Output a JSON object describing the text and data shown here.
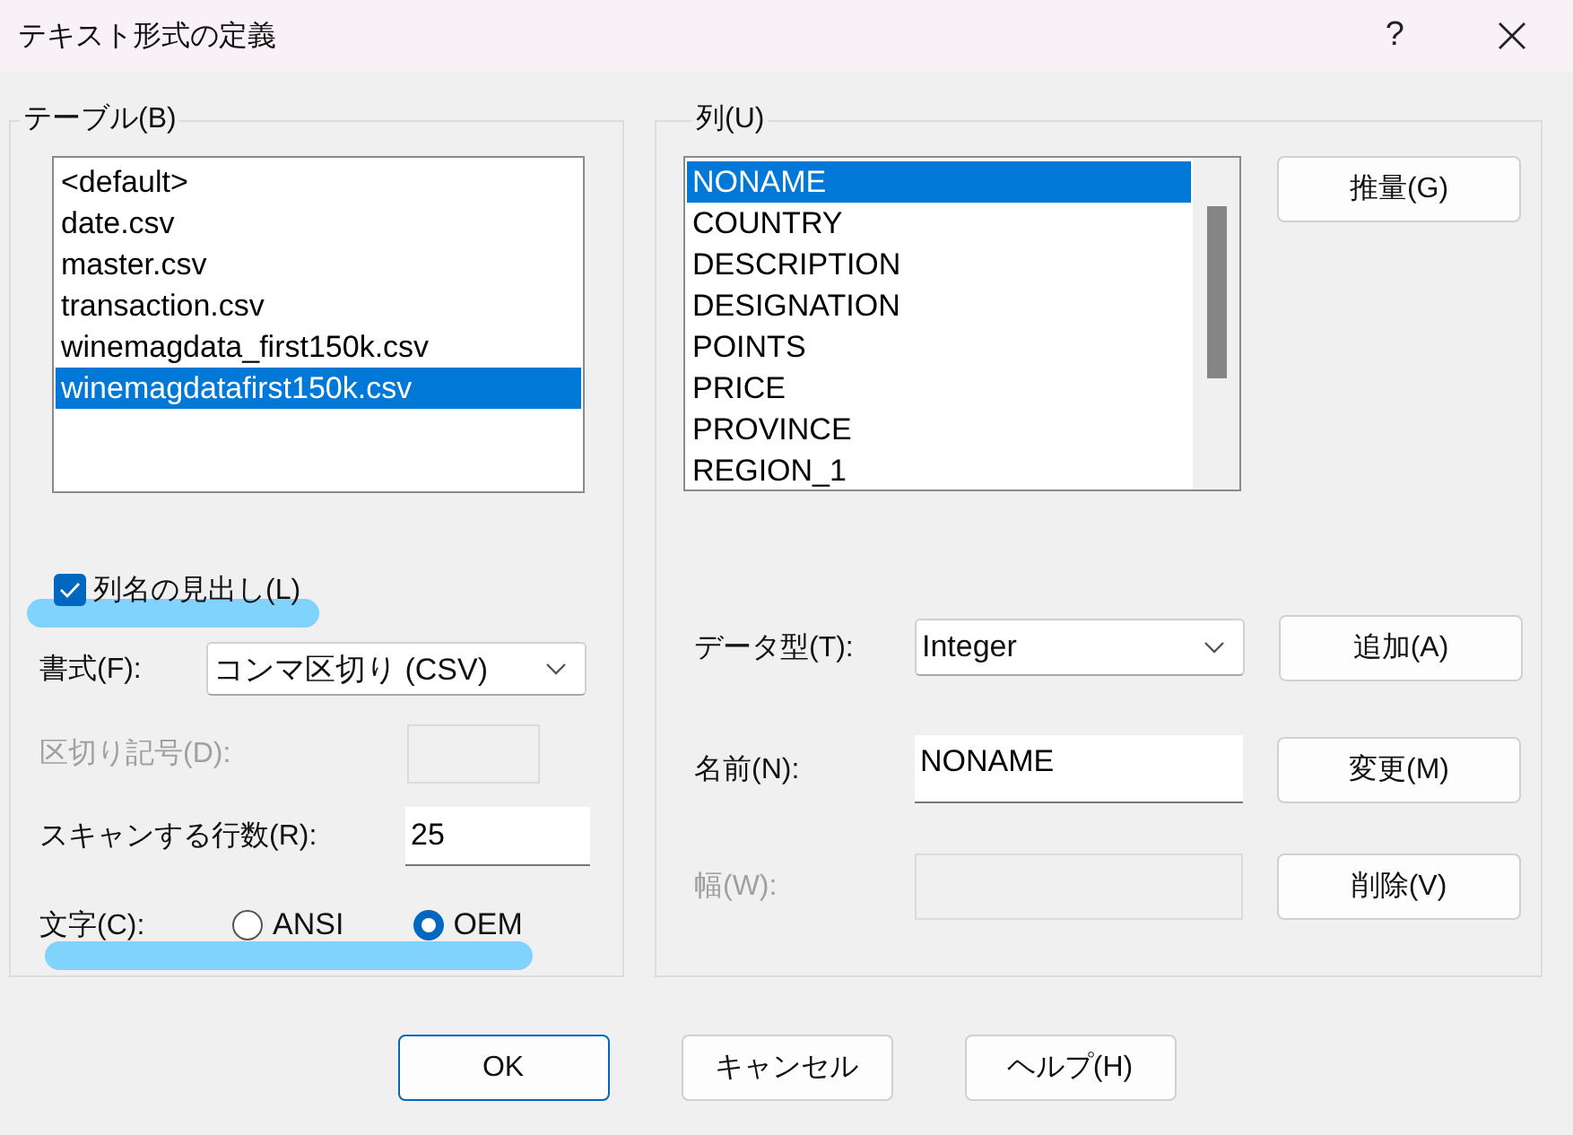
{
  "window": {
    "title": "テキスト形式の定義",
    "help_button": "?"
  },
  "table_group": {
    "label": "テーブル(B)",
    "tables": [
      {
        "name": "<default>",
        "selected": false
      },
      {
        "name": "date.csv",
        "selected": false
      },
      {
        "name": "master.csv",
        "selected": false
      },
      {
        "name": "transaction.csv",
        "selected": false
      },
      {
        "name": "winemagdata_first150k.csv",
        "selected": false
      },
      {
        "name": "winemagdatafirst150k.csv",
        "selected": true
      }
    ],
    "header_checkbox": {
      "label": "列名の見出し(L)",
      "checked": true
    },
    "format": {
      "label": "書式(F):",
      "value": "コンマ区切り (CSV)"
    },
    "delimiter": {
      "label": "区切り記号(D):",
      "disabled": true
    },
    "scan_rows": {
      "label": "スキャンする行数(R):",
      "value": "25"
    },
    "charset": {
      "label": "文字(C):",
      "options": [
        {
          "label": "ANSI",
          "selected": false
        },
        {
          "label": "OEM",
          "selected": true
        }
      ]
    }
  },
  "column_group": {
    "label": "列(U)",
    "columns": [
      {
        "name": "NONAME",
        "selected": true
      },
      {
        "name": "COUNTRY",
        "selected": false
      },
      {
        "name": "DESCRIPTION",
        "selected": false
      },
      {
        "name": "DESIGNATION",
        "selected": false
      },
      {
        "name": "POINTS",
        "selected": false
      },
      {
        "name": "PRICE",
        "selected": false
      },
      {
        "name": "PROVINCE",
        "selected": false
      },
      {
        "name": "REGION_1",
        "selected": false
      }
    ],
    "guess_button": "推量(G)",
    "data_type": {
      "label": "データ型(T):",
      "value": "Integer",
      "button": "追加(A)"
    },
    "name": {
      "label": "名前(N):",
      "value": "NONAME",
      "button": "変更(M)"
    },
    "width": {
      "label": "幅(W):",
      "disabled": true,
      "button": "削除(V)"
    }
  },
  "buttons": [
    {
      "label": "OK",
      "default": true
    },
    {
      "label": "キャンセル",
      "default": false
    },
    {
      "label": "ヘルプ(H)",
      "default": false
    }
  ]
}
